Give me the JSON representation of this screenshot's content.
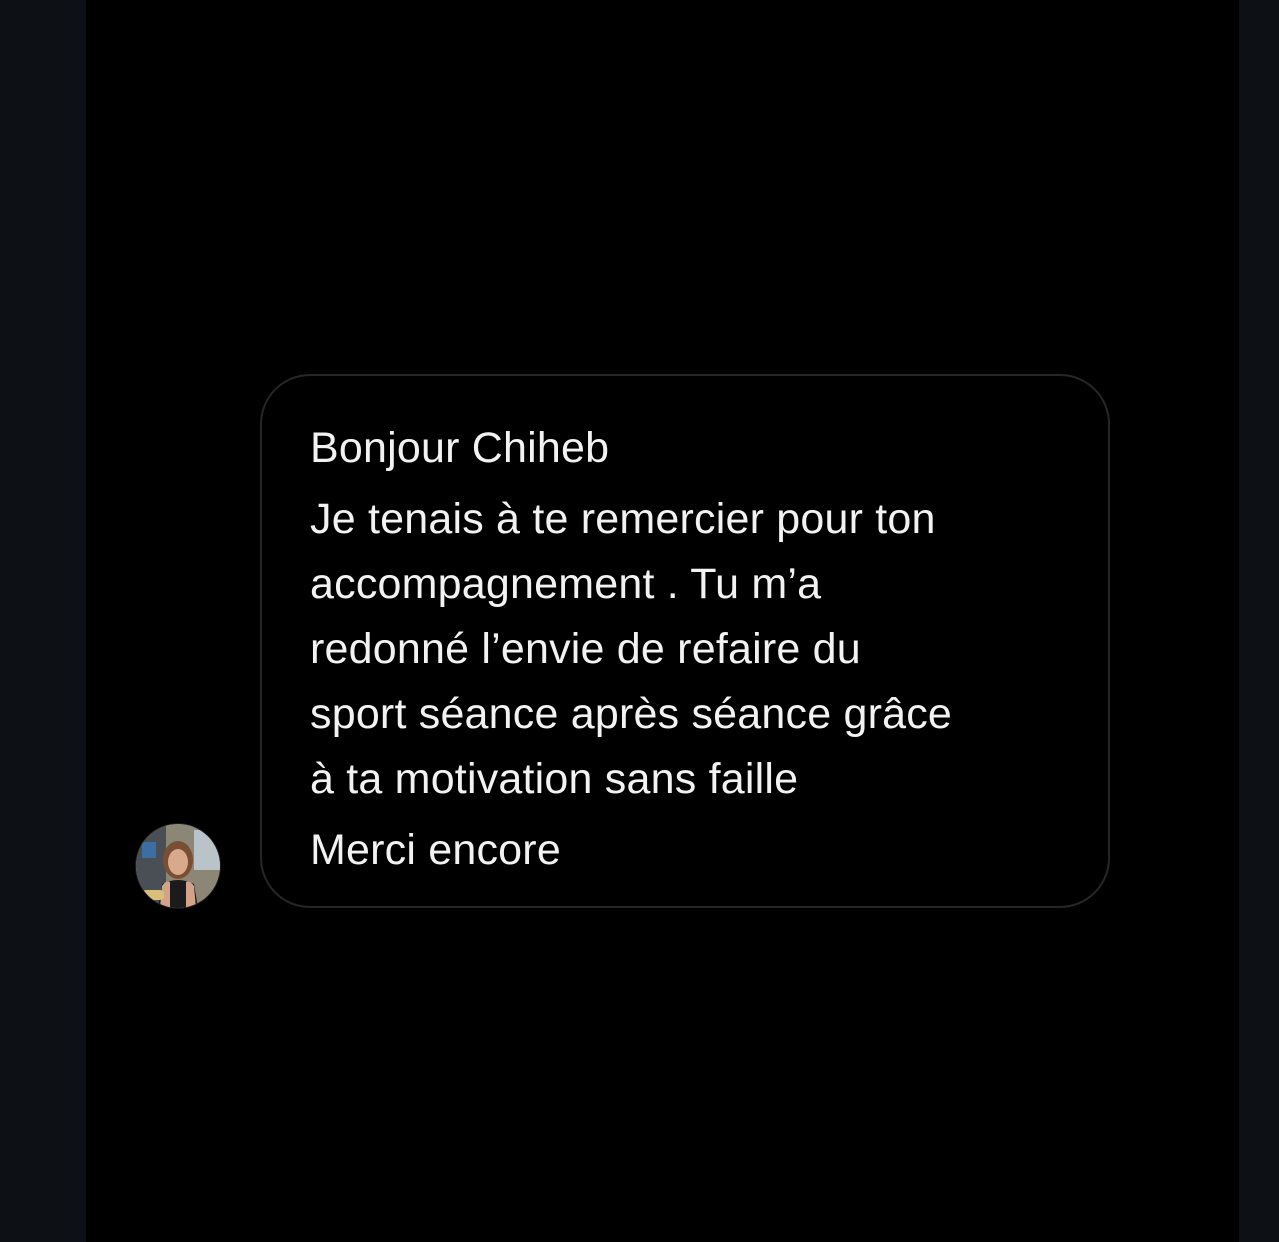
{
  "conversation": {
    "message": {
      "greeting": "Bonjour Chiheb",
      "body_lines": [
        "Je tenais à te remercier pour ton",
        "accompagnement . Tu m’a",
        "redonné l’envie de refaire du",
        "sport séance après séance grâce",
        "à ta motivation sans faille"
      ],
      "closing": "Merci encore"
    },
    "sender": {
      "avatar_icon": "profile-photo-avatar"
    }
  },
  "colors": {
    "background": "#000000",
    "outer_background": "#0d1116",
    "bubble_border": "#262626",
    "text": "#f2f2f2"
  }
}
